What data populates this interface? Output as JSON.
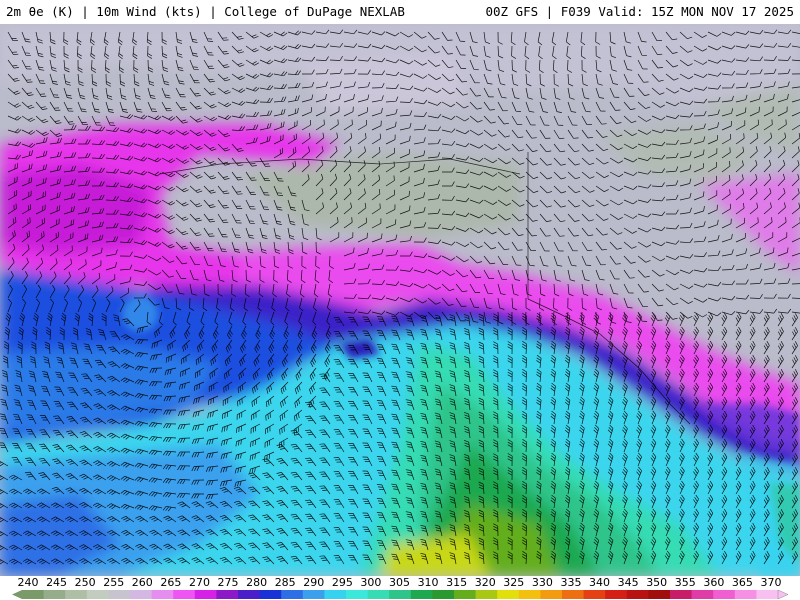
{
  "header": {
    "left_text": "2m θe (K) | 10m Wind (kts) | College of DuPage NEXLAB",
    "right_text": "00Z GFS | F039 Valid: 15Z MON NOV 17 2025"
  },
  "map": {
    "variable": "2m θe (K)",
    "overlay": "10m Wind (kts)",
    "model": "GFS",
    "run": "00Z",
    "forecast_hour": "F039",
    "valid_time": "15Z MON NOV 17 2025"
  },
  "colorbar": {
    "labels": [
      "240",
      "245",
      "250",
      "255",
      "260",
      "265",
      "270",
      "275",
      "280",
      "285",
      "290",
      "295",
      "300",
      "305",
      "310",
      "315",
      "320",
      "325",
      "330",
      "335",
      "340",
      "345",
      "350",
      "355",
      "360",
      "365",
      "370"
    ],
    "colors": [
      "#7a9a6a",
      "#95ad8a",
      "#aebfa6",
      "#c3cdbf",
      "#c7c4cf",
      "#d4b7e2",
      "#e68ef0",
      "#ee55f2",
      "#d622e6",
      "#8c18c8",
      "#4a1ec8",
      "#1832d8",
      "#2f6fe6",
      "#3aa0ee",
      "#36d2f0",
      "#3ae8dc",
      "#36dcb4",
      "#2ec48a",
      "#1ea850",
      "#2a9a30",
      "#64ae1e",
      "#a8c814",
      "#e2e00c",
      "#f4c010",
      "#f29a10",
      "#ee6e12",
      "#e44014",
      "#d41e16",
      "#b81212",
      "#a00e0e",
      "#c81e6a",
      "#e03ca8",
      "#f05ed2",
      "#f590e4",
      "#f8c0f0"
    ]
  }
}
